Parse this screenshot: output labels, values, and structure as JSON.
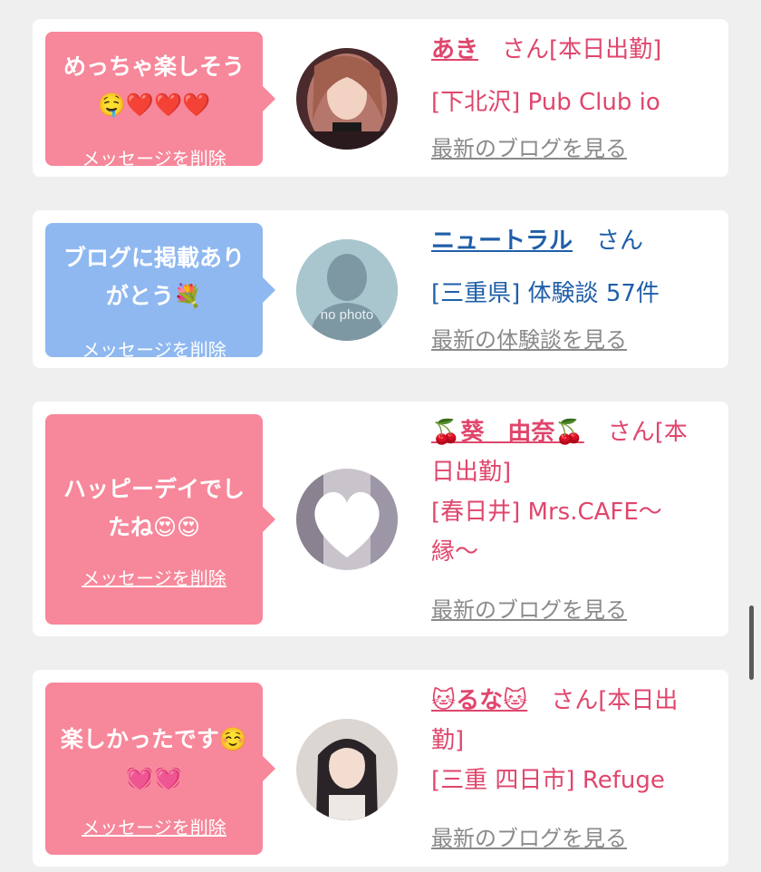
{
  "delete_label": "メッセージを削除",
  "cards": [
    {
      "message_l1": "めっちゃ楽しそう",
      "message_l2": "🤤❤️❤️❤️",
      "name": "あき",
      "info_l1_suffix": "　さん[本日出勤]",
      "info_l2": "[下北沢] Pub Club io",
      "link": "最新のブログを見る",
      "bubble_color": "#f7879a",
      "avatar": "girl-portrait"
    },
    {
      "message_l1": "ブログに掲載あり",
      "message_l2": "がとう💐",
      "name": "ニュートラル",
      "info_l1_suffix": "　さん",
      "info_l2": "[三重県] 体験談 57件",
      "link": "最新の体験談を見る",
      "bubble_color": "#8fb8f0",
      "avatar": "no-photo",
      "avatar_text": "no photo"
    },
    {
      "message_l1": "ハッピーデイでし",
      "message_l2": "たね😍😍",
      "name": "🍒葵　由奈🍒",
      "info_l1_suffix": "　さん[本",
      "info_l2": "日出勤]",
      "info_l3": "[春日井] Mrs.CAFE〜",
      "info_l4": "縁〜",
      "link": "最新のブログを見る",
      "bubble_color": "#f7879a",
      "avatar": "heart-blur"
    },
    {
      "message_l1": "楽しかったです☺️",
      "message_l2": "💓💓",
      "name": "🐱るな🐱",
      "info_l1_suffix": "　さん[本日出",
      "info_l2": "勤]",
      "info_l3": "[三重 四日市] Refuge",
      "link": "最新のブログを見る",
      "bubble_color": "#f7879a",
      "avatar": "girl-portrait-2"
    }
  ]
}
